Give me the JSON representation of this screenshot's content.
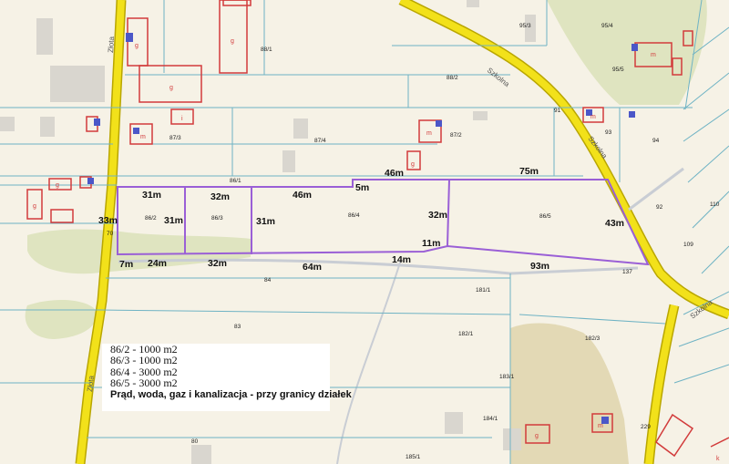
{
  "map": {
    "measurements": [
      {
        "id": "m-31-a",
        "text": "31m"
      },
      {
        "id": "m-32-a",
        "text": "32m"
      },
      {
        "id": "m-46-a",
        "text": "46m"
      },
      {
        "id": "m-5",
        "text": "5m"
      },
      {
        "id": "m-46-b",
        "text": "46m"
      },
      {
        "id": "m-75",
        "text": "75m"
      },
      {
        "id": "m-33",
        "text": "33m"
      },
      {
        "id": "m-31-b",
        "text": "31m"
      },
      {
        "id": "m-31-c",
        "text": "31m"
      },
      {
        "id": "m-32-b",
        "text": "32m"
      },
      {
        "id": "m-43",
        "text": "43m"
      },
      {
        "id": "m-11",
        "text": "11m"
      },
      {
        "id": "m-7",
        "text": "7m"
      },
      {
        "id": "m-24",
        "text": "24m"
      },
      {
        "id": "m-32-c",
        "text": "32m"
      },
      {
        "id": "m-64",
        "text": "64m"
      },
      {
        "id": "m-14",
        "text": "14m"
      },
      {
        "id": "m-93",
        "text": "93m"
      }
    ],
    "parcel_labels": {
      "p88_1": "88/1",
      "p95_3": "95/3",
      "p95_4": "95/4",
      "p95_5": "95/5",
      "p88_2": "88/2",
      "p87_3": "87/3",
      "p87_4": "87/4",
      "p87_2": "87/2",
      "p93": "93",
      "p94": "94",
      "p86_1": "86/1",
      "p86_2": "86/2",
      "p86_3": "86/3",
      "p86_4": "86/4",
      "p86_5": "86/5",
      "p92": "92",
      "p110": "110",
      "p109": "109",
      "p137": "137",
      "p70": "70",
      "p84": "84",
      "p181_1": "181/1",
      "p83": "83",
      "p182_1": "182/1",
      "p182_3": "182/3",
      "p183_1": "183/1",
      "p184_1": "184/1",
      "p185_1": "185/1",
      "p80": "80",
      "p229": "229",
      "p91": "91"
    },
    "streets": {
      "zlota_a": "Złota",
      "zlota_b": "Złota",
      "szkolna_a": "Szkolna",
      "szkolna_b": "Szkolna",
      "szkolna_c": "Szkolna"
    },
    "building_letters": {
      "g": "g",
      "m": "m",
      "i": "i",
      "k": "k"
    }
  },
  "legend": {
    "lines": [
      "86/2 - 1000 m2",
      "86/3 - 1000 m2",
      "86/4 - 3000 m2",
      "86/5 - 3000 m2"
    ],
    "utilities": "Prąd, woda, gaz i kanalizacja - przy granicy działek"
  },
  "colors": {
    "background": "#f6f2e6",
    "road": "#f2e11a",
    "road_edge": "#b9a600",
    "parcel_line": "#6fb3c4",
    "plot_outline": "#9a5fd6",
    "building": "#d23b3b",
    "green_area": "#dfe4c0",
    "tan_area": "#e3d9b5"
  }
}
